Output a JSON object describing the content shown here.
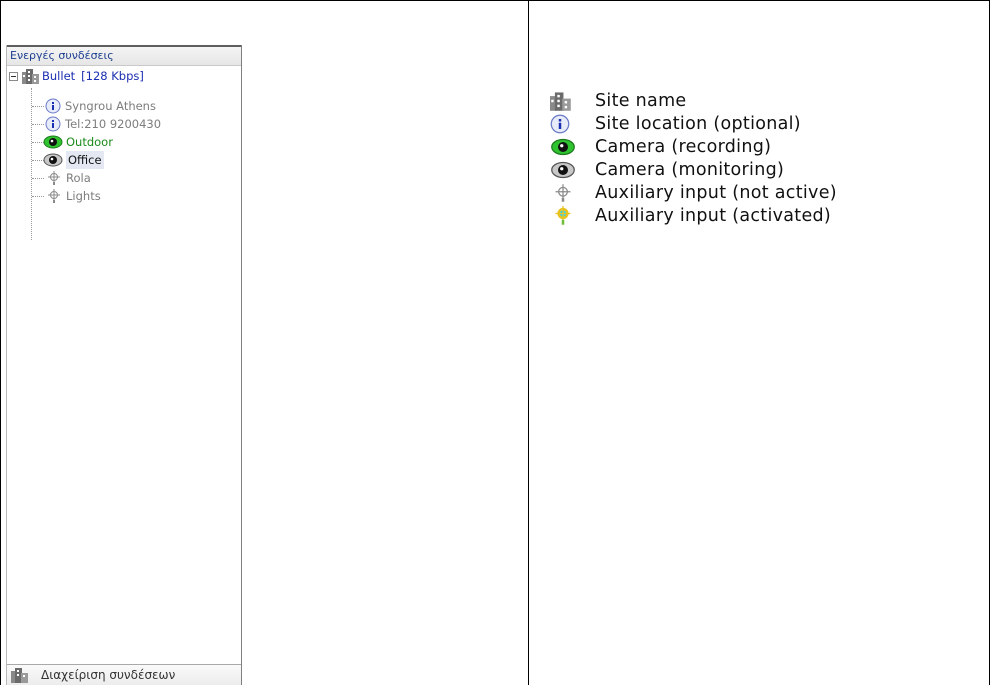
{
  "tree_panel": {
    "header": "Ενεργές συνδέσεις",
    "site": {
      "name": "Bullet",
      "bandwidth": "[128 Kbps]"
    },
    "children": [
      {
        "label": "Syngrou Athens",
        "icon": "info-icon"
      },
      {
        "label": "Tel:210 9200430",
        "icon": "info-icon"
      },
      {
        "label": "Outdoor",
        "icon": "camera-recording-icon"
      },
      {
        "label": "Office",
        "icon": "camera-monitoring-icon"
      },
      {
        "label": "Rola",
        "icon": "auxiliary-input-inactive-icon"
      },
      {
        "label": "Lights",
        "icon": "auxiliary-input-inactive-icon"
      }
    ],
    "footer": "Διαχείριση συνδέσεων"
  },
  "legend": [
    {
      "icon": "building-icon",
      "text": "Site name"
    },
    {
      "icon": "info-icon",
      "text": "Site location (optional)"
    },
    {
      "icon": "camera-recording-icon",
      "text": "Camera (recording)"
    },
    {
      "icon": "camera-monitoring-icon",
      "text": "Camera (monitoring)"
    },
    {
      "icon": "auxiliary-input-inactive-icon",
      "text": "Auxiliary input (not active)"
    },
    {
      "icon": "auxiliary-input-active-icon",
      "text": "Auxiliary input (activated)"
    }
  ],
  "colors": {
    "recording_green": "#2fc42f",
    "site_label_blue": "#1a2fb0",
    "child_label_gray": "#7d7d7d",
    "outdoor_green": "#1a8a1a",
    "aux_active_cyan": "#39d3e8"
  }
}
